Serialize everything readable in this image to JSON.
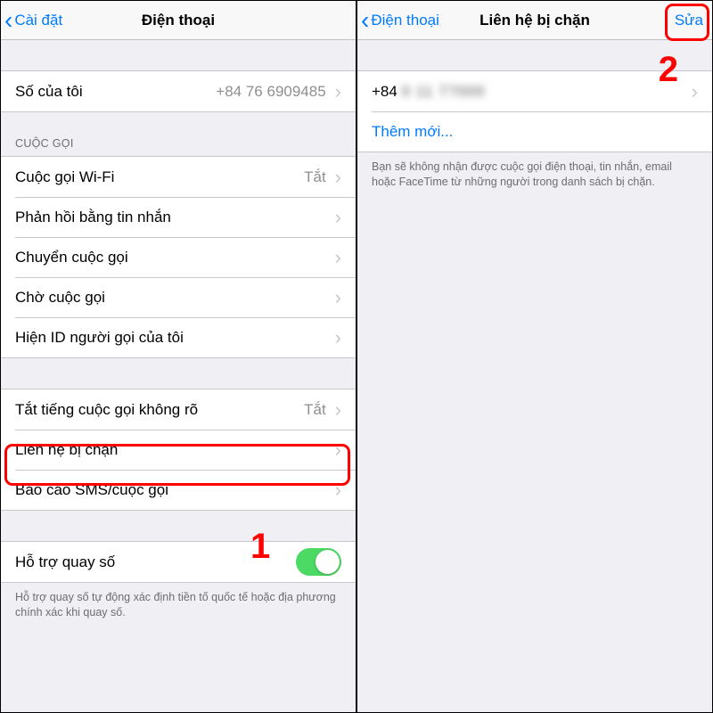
{
  "left": {
    "nav": {
      "back": "Cài đặt",
      "title": "Điện thoại"
    },
    "myNumber": {
      "label": "Số của tôi",
      "value": "+84 76 6909485"
    },
    "callsHeader": "CUỘC GỌI",
    "wifiCall": {
      "label": "Cuộc gọi Wi-Fi",
      "value": "Tắt"
    },
    "replySms": {
      "label": "Phản hồi bằng tin nhắn"
    },
    "forward": {
      "label": "Chuyển cuộc gọi"
    },
    "waiting": {
      "label": "Chờ cuộc gọi"
    },
    "callerId": {
      "label": "Hiện ID người gọi của tôi"
    },
    "silence": {
      "label": "Tắt tiếng cuộc gọi không rõ",
      "value": "Tắt"
    },
    "blocked": {
      "label": "Liên hệ bị chặn"
    },
    "report": {
      "label": "Báo cáo SMS/cuộc gọi"
    },
    "dialAssist": {
      "label": "Hỗ trợ quay số"
    },
    "dialAssistFooter": "Hỗ trợ quay số tự động xác định tiền tố quốc tế hoặc địa phương chính xác khi quay số.",
    "step": "1"
  },
  "right": {
    "nav": {
      "back": "Điện thoại",
      "title": "Liên hệ bị chặn",
      "edit": "Sửa"
    },
    "entry": {
      "prefix": "+84",
      "hidden": "0 11 77000"
    },
    "addNew": "Thêm mới...",
    "footer": "Bạn sẽ không nhận được cuộc gọi điện thoại, tin nhắn, email hoặc FaceTime từ những người trong danh sách bị chặn.",
    "step": "2"
  }
}
